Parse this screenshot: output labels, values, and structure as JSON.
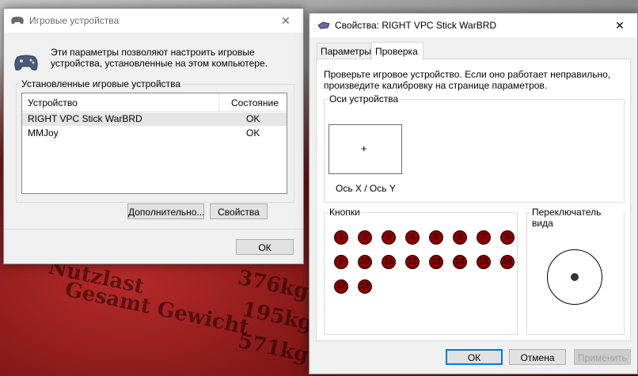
{
  "background": {
    "texts": [
      "Nutzlast",
      "376kg",
      "Gesamt Gewicht",
      "195kg",
      "571kg"
    ]
  },
  "game_window": {
    "title": "Игровые устройства",
    "description": "Эти параметры позволяют настроить игровые устройства, установленные на этом компьютере.",
    "group_label": "Установленные игровые устройства",
    "columns": [
      "Устройство",
      "Состояние"
    ],
    "devices": [
      {
        "name": "RIGHT VPC Stick WarBRD",
        "status": "OK"
      },
      {
        "name": "MMJoy",
        "status": "OK"
      }
    ],
    "advanced_label": "Дополнительно...",
    "properties_label": "Свойства",
    "ok_label": "ОК"
  },
  "props_window": {
    "title": "Свойства: RIGHT VPC Stick WarBRD",
    "tabs": [
      "Параметры",
      "Проверка"
    ],
    "active_tab": "Проверка",
    "instructions": "Проверьте игровое устройство. Если оно работает неправильно, произведите калибровку на странице параметров.",
    "axes_group_label": "Оси устройства",
    "axes_caption": "Ось X / Ось Y",
    "cursor_symbol": "+",
    "buttons_group_label": "Кнопки",
    "buttons": [
      "1",
      "2",
      "3",
      "4",
      "5",
      "6",
      "7",
      "8",
      "9",
      "10",
      "11",
      "12",
      "13",
      "14",
      "15",
      "16",
      "17",
      "18"
    ],
    "hat_group_label": "Переключатель вида",
    "ok_label": "ОК",
    "cancel_label": "Отмена",
    "apply_label": "Применить"
  },
  "colors": {
    "accent": "#0078d7",
    "button_fill": "#8b0000",
    "selection": "#e5e5e5"
  }
}
